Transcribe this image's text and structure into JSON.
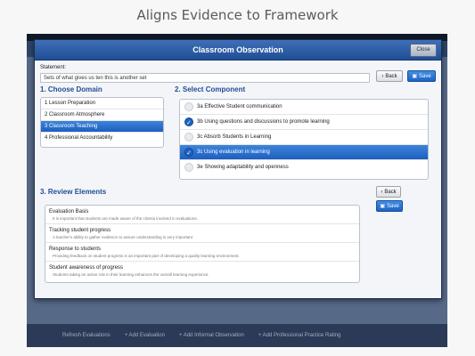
{
  "headline": "Aligns Evidence to Framework",
  "modal": {
    "title": "Classroom Observation",
    "close_label": "Close"
  },
  "statement": {
    "label": "Statement:",
    "value": "Sets of what gives us ten this is another set"
  },
  "top_actions": {
    "back_label": "Back",
    "save_label": "Save"
  },
  "domain": {
    "heading": "1. Choose Domain",
    "items": [
      {
        "label": "1 Lesson Preparation",
        "selected": false
      },
      {
        "label": "2 Classroom Atmosphere",
        "selected": false
      },
      {
        "label": "3 Classroom Teaching",
        "selected": true
      },
      {
        "label": "4 Professional Accountability",
        "selected": false
      }
    ]
  },
  "component": {
    "heading": "2. Select Component",
    "items": [
      {
        "label": "3a Effective Student communication",
        "checked": false,
        "selected": false
      },
      {
        "label": "3b Using questions and discussions to promote learning",
        "checked": true,
        "selected": false
      },
      {
        "label": "3c Absorb Students in Learning",
        "checked": false,
        "selected": false
      },
      {
        "label": "3c Using evaluation in learning",
        "checked": true,
        "selected": true
      },
      {
        "label": "3e Showing adaptability and openness",
        "checked": false,
        "selected": false
      }
    ]
  },
  "review": {
    "heading": "3. Review Elements",
    "back_label": "Back",
    "save_label": "Save",
    "items": [
      {
        "title": "Evaluation Basis",
        "desc": "It is important that students are made aware of the criteria involved in evaluations."
      },
      {
        "title": "Tracking student progress",
        "desc": "A teacher's ability to gather evidence to assure understanding is very important"
      },
      {
        "title": "Response to students",
        "desc": "Providing feedback on student progress is an important part of developing a quality learning environment."
      },
      {
        "title": "Student awareness of progress",
        "desc": "Students taking an active role in their learning enhances the overall learning experience."
      }
    ]
  },
  "bottom_bar": {
    "items": [
      "Refresh Evaluations",
      "+ Add Evaluation",
      "+ Add Informal Observation",
      "+ Add Professional Practice Rating"
    ]
  }
}
